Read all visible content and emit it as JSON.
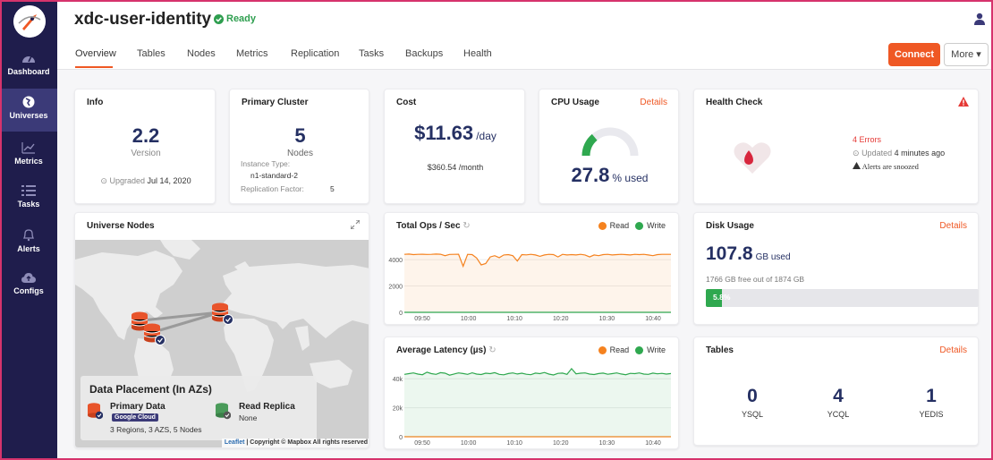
{
  "sidebar": {
    "items": [
      {
        "label": "Dashboard",
        "icon": "gauge-icon"
      },
      {
        "label": "Universes",
        "icon": "globe-icon"
      },
      {
        "label": "Metrics",
        "icon": "line-chart-icon"
      },
      {
        "label": "Tasks",
        "icon": "list-icon"
      },
      {
        "label": "Alerts",
        "icon": "bell-icon"
      },
      {
        "label": "Configs",
        "icon": "cloud-upload-icon"
      }
    ]
  },
  "header": {
    "title": "xdc-user-identity",
    "status": "Ready"
  },
  "tabs": [
    "Overview",
    "Tables",
    "Nodes",
    "Metrics",
    "Replication",
    "Tasks",
    "Backups",
    "Health"
  ],
  "actions": {
    "connect": "Connect",
    "more": "More ▾"
  },
  "info": {
    "title": "Info",
    "version": "2.2",
    "version_label": "Version",
    "upgraded_prefix": "Upgraded",
    "upgraded_date": "Jul 14, 2020"
  },
  "cluster": {
    "title": "Primary Cluster",
    "nodes": "5",
    "nodes_label": "Nodes",
    "instance_label": "Instance Type:",
    "instance_value": "n1-standard-2",
    "rf_label": "Replication Factor:",
    "rf_value": "5"
  },
  "cost": {
    "title": "Cost",
    "day": "$11.63",
    "day_unit": "/day",
    "month": "$360.54 /month"
  },
  "cpu": {
    "title": "CPU Usage",
    "details": "Details",
    "value": "27.8",
    "unit": "% used",
    "percent": 27.8
  },
  "health": {
    "title": "Health Check",
    "errors": "4 Errors",
    "updated_prefix": "Updated",
    "updated": "4 minutes ago",
    "snoozed": "Alerts are snoozed"
  },
  "map": {
    "title": "Universe Nodes",
    "placement_title": "Data Placement (In AZs)",
    "primary_title": "Primary Data",
    "provider": "Google Cloud",
    "primary_info": "3 Regions, 3 AZS, 5 Nodes",
    "replica_title": "Read Replica",
    "replica_info": "None",
    "attribution_link": "Leaflet",
    "attribution": " | Copyright © Mapbox All rights reserved"
  },
  "ops": {
    "title": "Total Ops / Sec",
    "legend_read": "Read",
    "legend_write": "Write"
  },
  "latency": {
    "title": "Average Latency (µs)",
    "legend_read": "Read",
    "legend_write": "Write"
  },
  "disk": {
    "title": "Disk Usage",
    "details": "Details",
    "used": "107.8",
    "used_unit": "GB used",
    "free": "1766 GB free out of 1874 GB",
    "percent_label": "5.8%",
    "percent": 5.8
  },
  "tables": {
    "title": "Tables",
    "details": "Details",
    "items": [
      {
        "count": "0",
        "label": "YSQL"
      },
      {
        "count": "4",
        "label": "YCQL"
      },
      {
        "count": "1",
        "label": "YEDIS"
      }
    ]
  },
  "colors": {
    "accent": "#ef5824",
    "read": "#f5821f",
    "write": "#2fa84f",
    "navy": "#1f1d4c",
    "ready": "#2e9e4f"
  },
  "chart_data": [
    {
      "type": "area",
      "title": "Total Ops / Sec",
      "x_ticks": [
        "09:50",
        "10:00",
        "10:10",
        "10:20",
        "10:30",
        "10:40"
      ],
      "y_ticks": [
        "0",
        "2000",
        "4000"
      ],
      "ylim": [
        0,
        5500
      ],
      "series": [
        {
          "name": "Read",
          "values": [
            4400,
            4420,
            4380,
            4400,
            4410,
            4390,
            4400,
            4420,
            4410,
            4300,
            4390,
            4400,
            4410,
            3500,
            4400,
            4380,
            4120,
            3600,
            3700,
            4200,
            4300,
            4150,
            4350,
            4380,
            4300,
            3900,
            4380,
            4360,
            4400,
            4350,
            4250,
            4350,
            4400,
            4380,
            4200,
            4400,
            4350,
            4380,
            4350,
            4400,
            4350,
            4200,
            4350,
            4300,
            4380,
            4400,
            4350,
            4380,
            4400,
            4380,
            4350,
            4400,
            4380,
            4400,
            4350,
            4300,
            4380,
            4400,
            4400,
            4400
          ]
        },
        {
          "name": "Write",
          "values": [
            0,
            0,
            0,
            0,
            0,
            0,
            0,
            0,
            0,
            0,
            0,
            0,
            0,
            0,
            0,
            0,
            0,
            0,
            0,
            0,
            0,
            0,
            0,
            0,
            0,
            0,
            0,
            0,
            0,
            0,
            0,
            0,
            0,
            0,
            0,
            0,
            0,
            0,
            0,
            0,
            0,
            0,
            0,
            0,
            0,
            0,
            0,
            0,
            0,
            0,
            0,
            0,
            0,
            0,
            0,
            0,
            0,
            0,
            0,
            0
          ]
        }
      ]
    },
    {
      "type": "area",
      "title": "Average Latency (µs)",
      "x_ticks": [
        "09:50",
        "10:00",
        "10:10",
        "10:20",
        "10:30",
        "10:40"
      ],
      "y_ticks": [
        "0",
        "20k",
        "40k"
      ],
      "ylim": [
        0,
        50000
      ],
      "series": [
        {
          "name": "Read",
          "values": [
            0,
            0,
            0,
            0,
            0,
            0,
            0,
            0,
            0,
            0,
            0,
            0,
            0,
            0,
            0,
            0,
            0,
            0,
            0,
            0,
            0,
            0,
            0,
            0,
            0,
            0,
            0,
            0,
            0,
            0,
            0,
            0,
            0,
            0,
            0,
            0,
            0,
            0,
            0,
            0,
            0,
            0,
            0,
            0,
            0,
            0,
            0,
            0,
            0,
            0,
            0,
            0,
            0,
            0,
            0,
            0,
            0,
            0,
            0,
            0
          ]
        },
        {
          "name": "Write",
          "values": [
            43000,
            43500,
            44000,
            43200,
            42800,
            44500,
            43500,
            43000,
            44200,
            43800,
            42500,
            43300,
            44000,
            43600,
            43000,
            44100,
            43200,
            42900,
            43800,
            43500,
            44200,
            43000,
            42700,
            43600,
            44000,
            43300,
            43800,
            43100,
            42800,
            43900,
            43500,
            44300,
            43200,
            42600,
            43700,
            43900,
            43000,
            47000,
            43400,
            43800,
            44000,
            43200,
            42900,
            43600,
            43900,
            43100,
            43500,
            44000,
            43300,
            42800,
            43700,
            43500,
            44000,
            43200,
            43000,
            43900,
            43400,
            43700,
            43200,
            43600
          ]
        }
      ]
    }
  ]
}
